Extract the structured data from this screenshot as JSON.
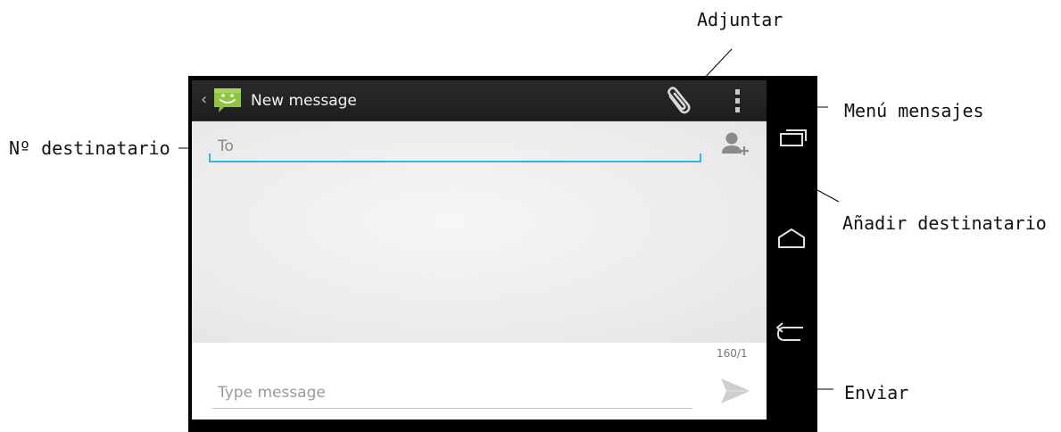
{
  "callouts": {
    "attach": "Adjuntar",
    "menu": "Menú mensajes",
    "recipient_number": "Nº destinatario",
    "add_recipient": "Añadir destinatario",
    "send": "Enviar"
  },
  "actionbar": {
    "title": "New message",
    "back_glyph": "‹"
  },
  "compose": {
    "to_placeholder": "To",
    "to_value": "",
    "char_counter": "160/1",
    "message_placeholder": "Type message",
    "message_value": ""
  },
  "icons": {
    "app": "messaging-app-icon",
    "attach": "paperclip-icon",
    "menu": "overflow-menu-icon",
    "add_recipient": "add-contact-icon",
    "send": "send-icon",
    "recent_apps": "recent-apps-icon",
    "home": "home-icon",
    "back": "back-icon"
  },
  "colors": {
    "accent": "#33b5e5",
    "app_icon": "#8fc63f",
    "actionbar": "#222222",
    "nav_bg": "#000000"
  }
}
